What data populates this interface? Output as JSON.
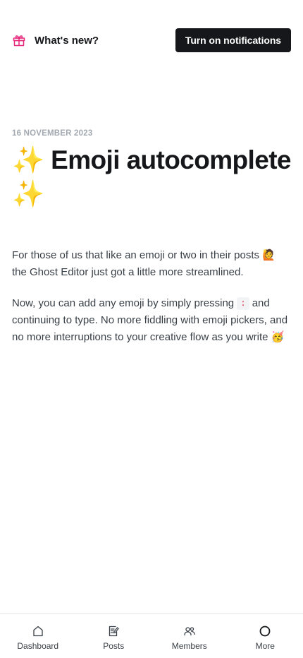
{
  "header": {
    "whats_new_icon": "gift-icon",
    "whats_new_label": "What's new?",
    "notify_button_label": "Turn on notifications"
  },
  "article": {
    "date": "16 NOVEMBER 2023",
    "title": "✨ Emoji autocomplete ✨",
    "paragraph1": "For those of us that like an emoji or two in their posts 🙋 the Ghost Editor just got a little more streamlined.",
    "paragraph2_before": "Now, you can add any emoji by simply pressing",
    "paragraph2_key": ":",
    "paragraph2_after": "and continuing to type. No more fiddling with emoji pickers, and no more interruptions to your creative flow as you write 🥳"
  },
  "tabbar": {
    "items": [
      {
        "label": "Dashboard",
        "icon": "home-icon"
      },
      {
        "label": "Posts",
        "icon": "edit-icon"
      },
      {
        "label": "Members",
        "icon": "members-icon"
      },
      {
        "label": "More",
        "icon": "circle-icon"
      }
    ]
  },
  "colors": {
    "gift_accent": "#e6267a",
    "button_bg": "#15171a",
    "code_text": "#e4153c",
    "date_text": "#a3a9b0"
  }
}
